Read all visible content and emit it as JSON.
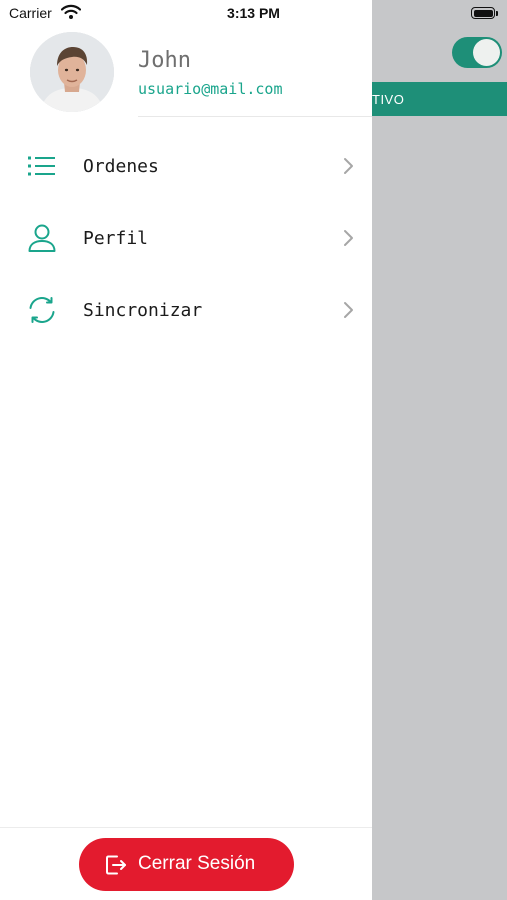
{
  "status_bar": {
    "carrier": "Carrier",
    "time": "3:13 PM"
  },
  "background_screen": {
    "banner_text": "TIVO",
    "toggle_on": true,
    "accent": "#1e8f78"
  },
  "drawer": {
    "user": {
      "name": "John",
      "email": "usuario@mail.com",
      "avatar_icon": "user-photo"
    },
    "menu": [
      {
        "label": "Ordenes",
        "icon": "list-icon"
      },
      {
        "label": "Perfil",
        "icon": "person-icon"
      },
      {
        "label": "Sincronizar",
        "icon": "sync-icon"
      }
    ],
    "logout": {
      "label": "Cerrar Sesión",
      "icon": "logout-icon",
      "color": "#e31b2e"
    }
  },
  "colors": {
    "accent_teal": "#1aa58c",
    "drawer_bg": "#ffffff",
    "overlay_bg": "#c6c7c9"
  }
}
